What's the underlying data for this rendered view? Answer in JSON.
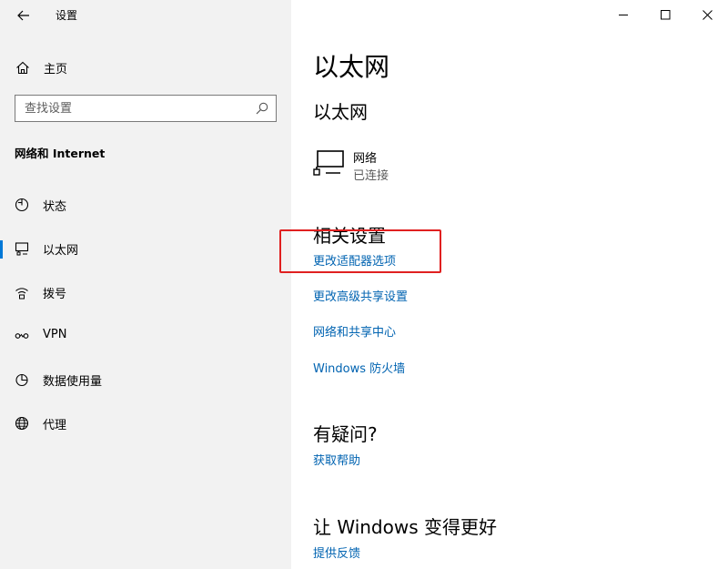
{
  "window": {
    "title": "设置",
    "back_icon": "back-arrow-icon",
    "controls": {
      "minimize_icon": "minimize-icon",
      "maximize_icon": "maximize-icon",
      "close_icon": "close-icon"
    }
  },
  "sidebar": {
    "home_label": "主页",
    "search_placeholder": "查找设置",
    "section_title": "网络和 Internet",
    "items": [
      {
        "label": "状态",
        "icon": "globe-status-icon",
        "active": false
      },
      {
        "label": "以太网",
        "icon": "ethernet-icon",
        "active": true
      },
      {
        "label": "拨号",
        "icon": "dialup-icon",
        "active": false
      },
      {
        "label": "VPN",
        "icon": "vpn-icon",
        "active": false
      },
      {
        "label": "数据使用量",
        "icon": "data-usage-icon",
        "active": false
      },
      {
        "label": "代理",
        "icon": "proxy-globe-icon",
        "active": false
      }
    ]
  },
  "main": {
    "title": "以太网",
    "subtitle": "以太网",
    "network": {
      "name": "网络",
      "status": "已连接",
      "icon": "ethernet-monitor-icon"
    },
    "related": {
      "title": "相关设置",
      "links": [
        "更改适配器选项",
        "更改高级共享设置",
        "网络和共享中心",
        "Windows 防火墙"
      ]
    },
    "questions": {
      "title": "有疑问?",
      "link": "获取帮助"
    },
    "improve": {
      "title": "让 Windows 变得更好",
      "link": "提供反馈"
    }
  },
  "colors": {
    "accent": "#0078d7",
    "link": "#0063b1",
    "highlight": "#e02020",
    "sidebar_bg": "#f2f2f2"
  }
}
